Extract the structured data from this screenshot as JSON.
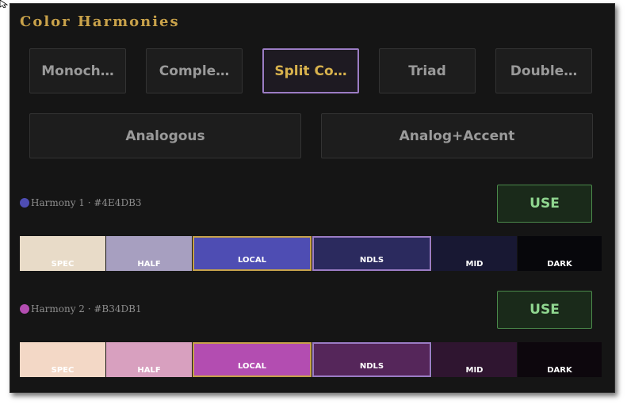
{
  "title": "Color Harmonies",
  "harmony_buttons_row1": [
    {
      "label": "Monoch…"
    },
    {
      "label": "Comple…"
    },
    {
      "label": "Split Co…"
    },
    {
      "label": "Triad"
    },
    {
      "label": "Double…"
    }
  ],
  "harmony_buttons_row2": [
    {
      "label": "Analogous"
    },
    {
      "label": "Analog+Accent"
    }
  ],
  "harmonies": [
    {
      "label": "Harmony 1 · #4E4DB3",
      "dot_color": "#4e4db3",
      "use_label": "USE",
      "swatches": [
        {
          "label": "SPEC",
          "color": "#e8dbc8"
        },
        {
          "label": "HALF",
          "color": "#a79fc0"
        },
        {
          "label": "LOCAL",
          "color": "#4e4db3"
        },
        {
          "label": "NDLS",
          "color": "#2b2a5e"
        },
        {
          "label": "MID",
          "color": "#181833"
        },
        {
          "label": "DARK",
          "color": "#07070b"
        }
      ]
    },
    {
      "label": "Harmony 2 · #B34DB1",
      "dot_color": "#b34db1",
      "use_label": "USE",
      "swatches": [
        {
          "label": "SPEC",
          "color": "#f3d8c6"
        },
        {
          "label": "HALF",
          "color": "#d8a0bf"
        },
        {
          "label": "LOCAL",
          "color": "#b34db1"
        },
        {
          "label": "NDLS",
          "color": "#55265a"
        },
        {
          "label": "MID",
          "color": "#2f1530"
        },
        {
          "label": "DARK",
          "color": "#0d070d"
        }
      ]
    }
  ],
  "colors": {
    "accent_gold": "#c9a24a",
    "active_border": "#9b7cc4",
    "use_green": "#8fd68f"
  }
}
